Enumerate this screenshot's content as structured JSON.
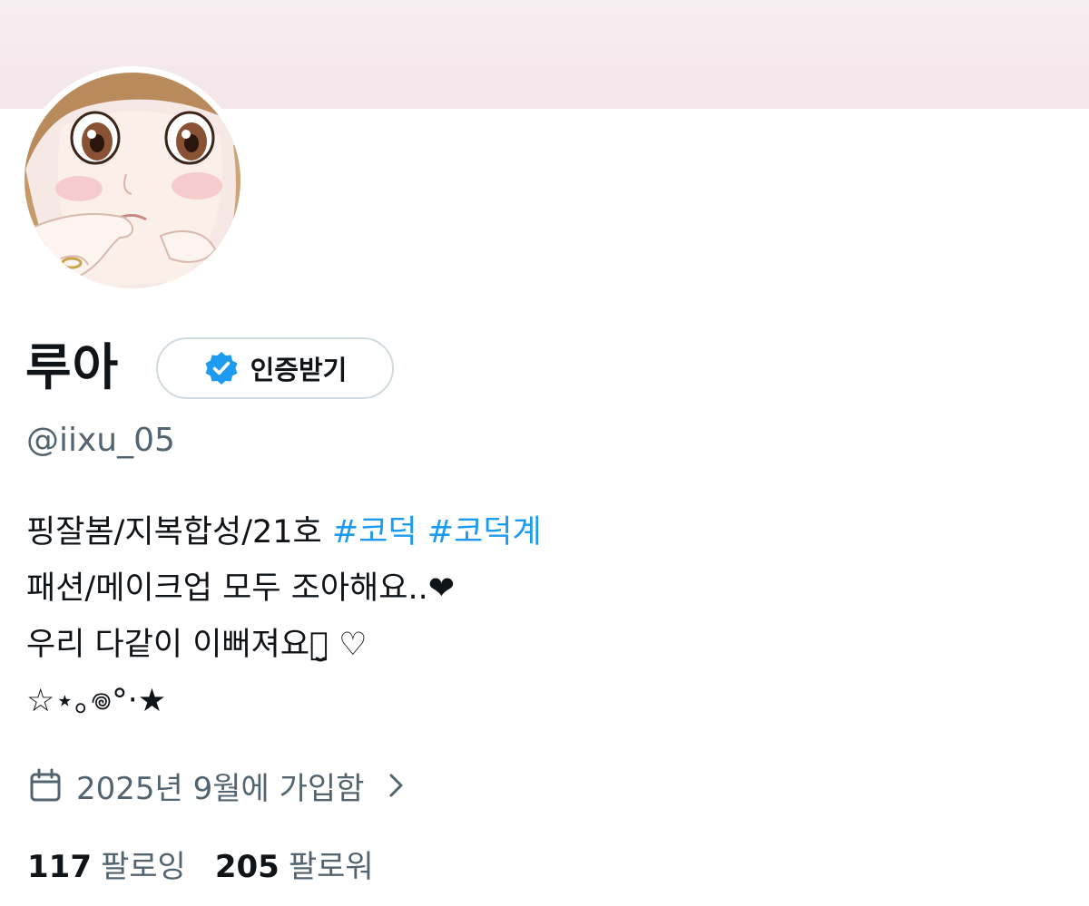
{
  "profile": {
    "display_name": "루아",
    "verify_button_label": "인증받기",
    "handle": "@iixu_05",
    "avatar": "anime-girl-portrait"
  },
  "bio": {
    "line1_text": "핑잘봄/지복합성/21호",
    "hashtags": [
      "#코덕",
      "#코덕계"
    ],
    "line2": "패션/메이크업 모두 조아해요..❤︎",
    "line3": "우리 다같이 이뻐져요ꪔ̤̮ ♡",
    "line4": "☆⋆｡𖦹°‧★"
  },
  "joined": {
    "text": "2025년 9월에 가입함",
    "icon": "calendar-icon"
  },
  "stats": {
    "following_count": "117",
    "following_label": "팔로잉",
    "followers_count": "205",
    "followers_label": "팔로워"
  },
  "colors": {
    "banner": "#f3e5ea",
    "hashtag": "#1d9bf0",
    "verified_badge": "#1d9bf0",
    "secondary_text": "#536471",
    "border": "#cfd9de"
  }
}
